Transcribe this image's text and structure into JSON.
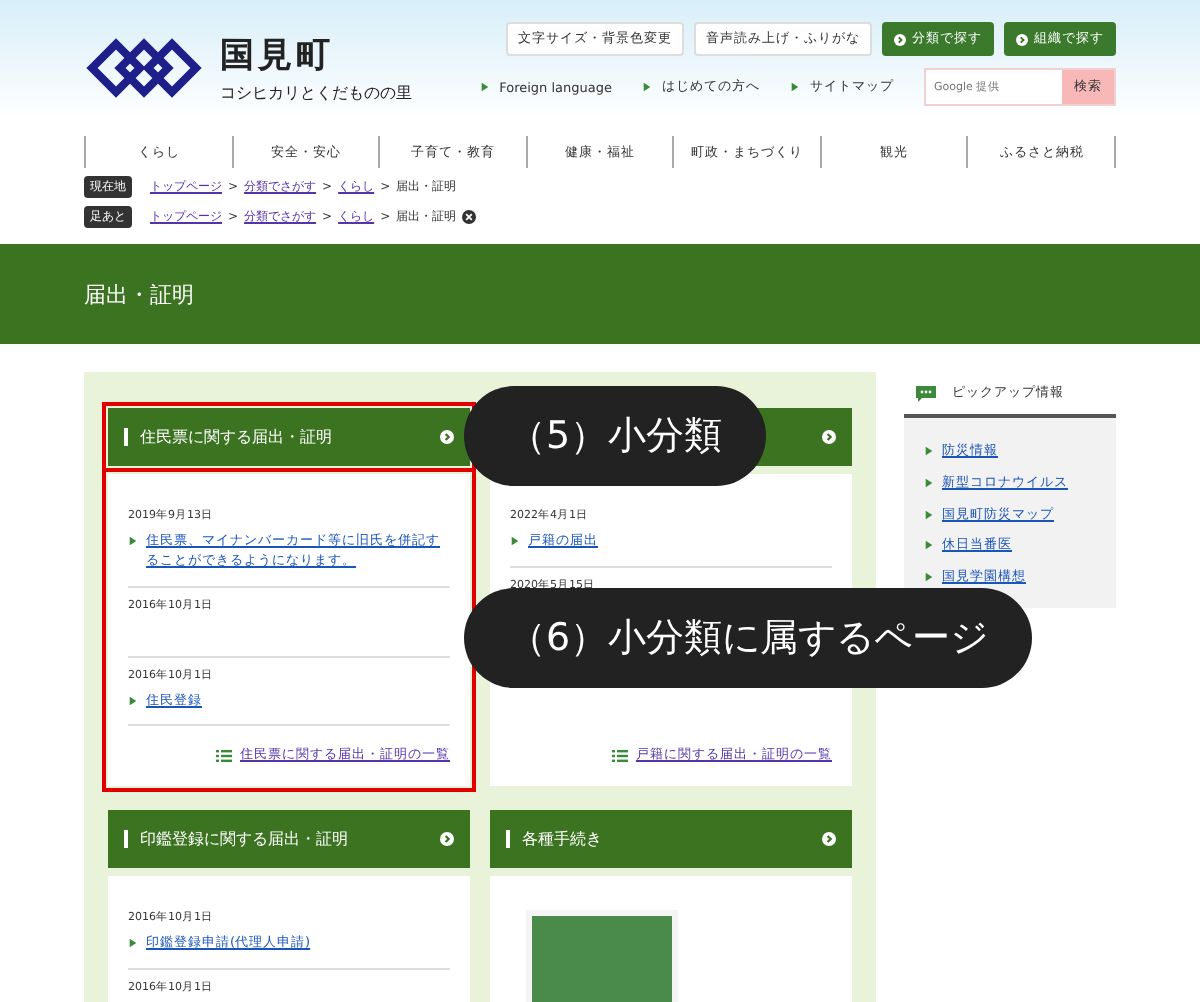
{
  "header": {
    "logo_title": "国見町",
    "tagline": "コシヒカリとくだものの里",
    "tool_buttons": [
      {
        "label": "文字サイズ・背景色変更",
        "kind": "plain"
      },
      {
        "label": "音声読み上げ・ふりがな",
        "kind": "plain"
      },
      {
        "label": "分類で探す",
        "kind": "green"
      },
      {
        "label": "組織で探す",
        "kind": "green"
      }
    ],
    "links": [
      "Foreign language",
      "はじめての方へ",
      "サイトマップ"
    ],
    "search": {
      "placeholder": "Google 提供",
      "button": "検索"
    }
  },
  "nav": [
    "くらし",
    "安全・安心",
    "子育て・教育",
    "健康・福祉",
    "町政・まちづくり",
    "観光",
    "ふるさと納税"
  ],
  "breadcrumbs": [
    {
      "badge": "現在地",
      "items": [
        "トップページ",
        "分類でさがす",
        "くらし"
      ],
      "separator": ">",
      "current": "届出・証明",
      "removable": false
    },
    {
      "badge": "足あと",
      "items": [
        "トップページ",
        "分類でさがす",
        "くらし"
      ],
      "separator": ">",
      "current": "届出・証明",
      "removable": true
    }
  ],
  "page_title": "届出・証明",
  "cards": [
    {
      "kind": "list",
      "title": "住民票に関する届出・証明",
      "highlighted": true,
      "entries": [
        {
          "date": "2019年9月13日",
          "link": "住民票、マイナンバーカード等に旧氏を併記することができるようになります。"
        },
        {
          "date": "2016年10月1日"
        },
        {
          "date": "2016年10月1日",
          "link": "住民登録"
        }
      ],
      "more": "住民票に関する届出・証明の一覧"
    },
    {
      "kind": "list",
      "highlighted": false,
      "entries": [
        {
          "date": "2022年4月1日",
          "link": "戸籍の届出"
        },
        {
          "date": "2020年5月15日"
        }
      ],
      "more": "戸籍に関する届出・証明の一覧"
    },
    {
      "kind": "list",
      "title": "印鑑登録に関する届出・証明",
      "highlighted": false,
      "entries": [
        {
          "date": "2016年10月1日",
          "link": "印鑑登録申請(代理人申請)"
        },
        {
          "date": "2016年10月1日"
        }
      ]
    },
    {
      "kind": "image",
      "title": "各種手続き",
      "highlighted": false
    }
  ],
  "pickup": {
    "title": "ピックアップ情報",
    "items": [
      "防災情報",
      "新型コロナウイルス",
      "国見町防災マップ",
      "休日当番医",
      "国見学園構想"
    ]
  },
  "callouts": [
    {
      "label": "（5）小分類"
    },
    {
      "label": "（6）小分類に属するページ"
    }
  ]
}
